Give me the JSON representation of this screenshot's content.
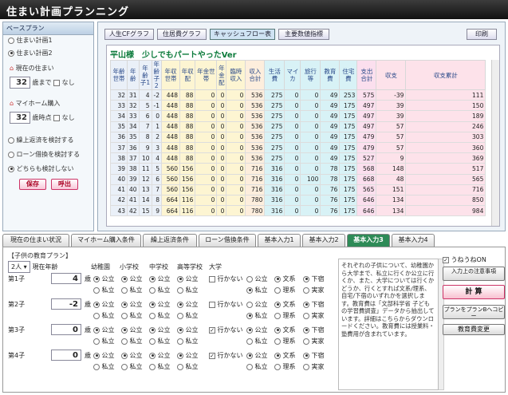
{
  "app": {
    "title": "住まい計画プランニング"
  },
  "left": {
    "plan_header": "ベースプラン",
    "plans": [
      {
        "label": "住まい計画1",
        "selected": false
      },
      {
        "label": "住まい計画2",
        "selected": true
      }
    ],
    "current_home": {
      "label": "現在の住まい",
      "age": "32",
      "age_suffix": "歳まで",
      "none_label": "なし"
    },
    "buy_home": {
      "label": "マイホーム購入",
      "age": "32",
      "age_suffix": "歳時点",
      "none_label": "なし"
    },
    "options": [
      {
        "label": "繰上返済を検討する",
        "selected": false
      },
      {
        "label": "ローン借換を検討する",
        "selected": false
      },
      {
        "label": "どちらも検討しない",
        "selected": true
      }
    ],
    "save_label": "保存",
    "load_label": "呼出"
  },
  "main": {
    "buttons": [
      "人生CFグラフ",
      "住居費グラフ",
      "キャッシュフロー表",
      "主要数値指標"
    ],
    "print_label": "印刷",
    "sheet_title": "平山様　少しでもパートやったVer",
    "columns": [
      "年齢世帯",
      "年齢",
      "年齢子1",
      "年齢子2",
      "年収世帯",
      "年収配",
      "年金世帯",
      "年金配",
      "臨時収入",
      "収入合計",
      "生活費",
      "マイカ",
      "旅行等",
      "教育費",
      "住宅費",
      "支出合計",
      "収支",
      "収支累計"
    ],
    "rows": [
      [
        "32",
        "31",
        "4",
        "-2",
        "448",
        "88",
        "0",
        "0",
        "0",
        "536",
        "275",
        "0",
        "0",
        "49",
        "253",
        "575",
        "-39",
        "111"
      ],
      [
        "33",
        "32",
        "5",
        "-1",
        "448",
        "88",
        "0",
        "0",
        "0",
        "536",
        "275",
        "0",
        "0",
        "49",
        "175",
        "497",
        "39",
        "150"
      ],
      [
        "34",
        "33",
        "6",
        "0",
        "448",
        "88",
        "0",
        "0",
        "0",
        "536",
        "275",
        "0",
        "0",
        "49",
        "175",
        "497",
        "39",
        "189"
      ],
      [
        "35",
        "34",
        "7",
        "1",
        "448",
        "88",
        "0",
        "0",
        "0",
        "536",
        "275",
        "0",
        "0",
        "49",
        "175",
        "497",
        "57",
        "246"
      ],
      [
        "36",
        "35",
        "8",
        "2",
        "448",
        "88",
        "0",
        "0",
        "0",
        "536",
        "275",
        "0",
        "0",
        "49",
        "175",
        "479",
        "57",
        "303"
      ],
      [
        "37",
        "36",
        "9",
        "3",
        "448",
        "88",
        "0",
        "0",
        "0",
        "536",
        "275",
        "0",
        "0",
        "49",
        "175",
        "479",
        "57",
        "360"
      ],
      [
        "38",
        "37",
        "10",
        "4",
        "448",
        "88",
        "0",
        "0",
        "0",
        "536",
        "275",
        "0",
        "0",
        "49",
        "175",
        "527",
        "9",
        "369"
      ],
      [
        "39",
        "38",
        "11",
        "5",
        "560",
        "156",
        "0",
        "0",
        "0",
        "716",
        "316",
        "0",
        "0",
        "78",
        "175",
        "568",
        "148",
        "517"
      ],
      [
        "40",
        "39",
        "12",
        "6",
        "560",
        "156",
        "0",
        "0",
        "0",
        "716",
        "316",
        "0",
        "100",
        "78",
        "175",
        "668",
        "48",
        "565"
      ],
      [
        "41",
        "40",
        "13",
        "7",
        "560",
        "156",
        "0",
        "0",
        "0",
        "716",
        "316",
        "0",
        "0",
        "76",
        "175",
        "565",
        "151",
        "716"
      ],
      [
        "42",
        "41",
        "14",
        "8",
        "664",
        "116",
        "0",
        "0",
        "0",
        "780",
        "316",
        "0",
        "0",
        "76",
        "175",
        "646",
        "134",
        "850"
      ],
      [
        "43",
        "42",
        "15",
        "9",
        "664",
        "116",
        "0",
        "0",
        "0",
        "780",
        "316",
        "0",
        "0",
        "76",
        "175",
        "646",
        "134",
        "984"
      ]
    ]
  },
  "tabs": [
    "現在の住まい状況",
    "マイホーム購入条件",
    "繰上返済条件",
    "ローン借換条件",
    "基本入力1",
    "基本入力2",
    "基本入力3",
    "基本入力4"
  ],
  "active_tab": 6,
  "edu": {
    "header": "【子供の教育プラン】",
    "count": "2人",
    "age_header": "現在年齢",
    "school_headers": [
      "幼稚園",
      "小学校",
      "中学校",
      "高等学校",
      "大学"
    ],
    "age_suffix": "歳",
    "public": "公立",
    "private": "私立",
    "notgo": "行かない",
    "lit": "文系",
    "sci": "理系",
    "home": "下宿",
    "live": "実家",
    "kids": [
      {
        "label": "第1子",
        "age": "4"
      },
      {
        "label": "第2子",
        "age": "-2"
      },
      {
        "label": "第3子",
        "age": "0"
      },
      {
        "label": "第4子",
        "age": "0"
      }
    ],
    "note": "それぞれの子供について、幼稚園から大学まで、私立に行くか公立に行くか、また、大学については行くかどうか、行くとすれば文系/理系、自宅/下宿のいずれかを選択します。教育費は「文部科学省 子どもの学習費調査」データから抽出しています。詳細はこちらからダウンロードください。教育費には授業料・塾費用が含まれています。",
    "link": "こちら"
  },
  "side": {
    "chk_label": "うねうねON",
    "btn1": "入力上の注意事項",
    "calc": "計 算",
    "copy": "プランをプランBへコピー",
    "edu": "教育費変更"
  }
}
